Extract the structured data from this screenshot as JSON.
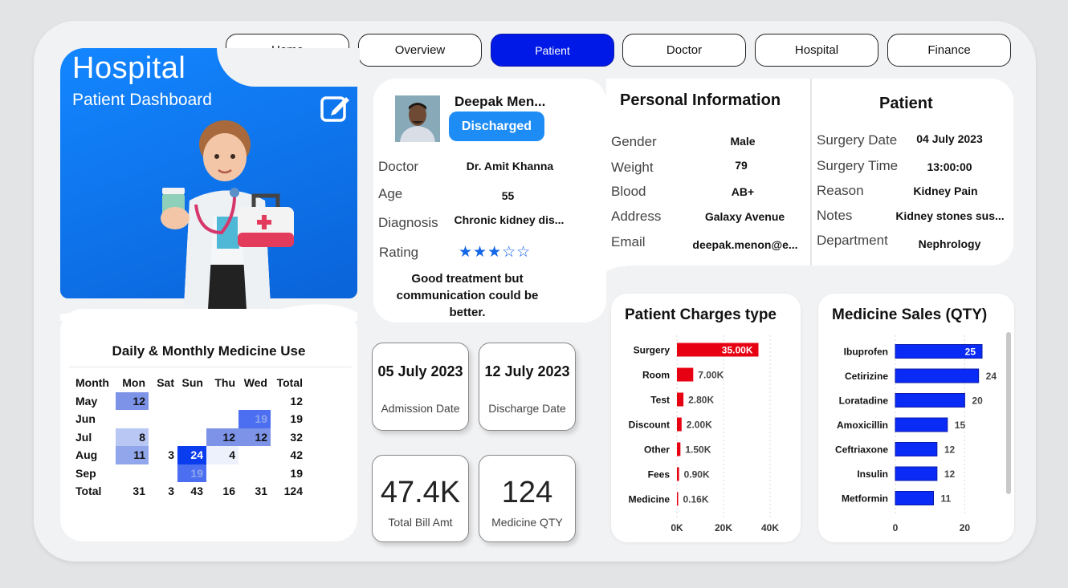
{
  "nav": [
    {
      "label": "Home",
      "active": false
    },
    {
      "label": "Overview",
      "active": false
    },
    {
      "label": "Patient",
      "active": true
    },
    {
      "label": "Doctor",
      "active": false
    },
    {
      "label": "Hospital",
      "active": false
    },
    {
      "label": "Finance",
      "active": false
    }
  ],
  "hero": {
    "title": "Hospital",
    "subtitle": "Patient Dashboard"
  },
  "medicine_use": {
    "title": "Daily & Monthly Medicine Use",
    "columns": [
      "Month",
      "Mon",
      "Sat",
      "Sun",
      "Thu",
      "Wed",
      "Total"
    ],
    "rows": [
      {
        "month": "May",
        "Mon": "12",
        "Sat": "",
        "Sun": "",
        "Thu": "",
        "Wed": "",
        "Total": "12"
      },
      {
        "month": "Jun",
        "Mon": "",
        "Sat": "",
        "Sun": "",
        "Thu": "",
        "Wed": "19",
        "Total": "19"
      },
      {
        "month": "Jul",
        "Mon": "8",
        "Sat": "",
        "Sun": "",
        "Thu": "12",
        "Wed": "12",
        "Total": "32"
      },
      {
        "month": "Aug",
        "Mon": "11",
        "Sat": "3",
        "Sun": "24",
        "Thu": "4",
        "Wed": "",
        "Total": "42"
      },
      {
        "month": "Sep",
        "Mon": "",
        "Sat": "",
        "Sun": "19",
        "Thu": "",
        "Wed": "",
        "Total": "19"
      }
    ],
    "total_row": {
      "month": "Total",
      "Mon": "31",
      "Sat": "3",
      "Sun": "43",
      "Thu": "16",
      "Wed": "31",
      "Total": "124"
    }
  },
  "patient": {
    "name": "Deepak Men...",
    "status": "Discharged",
    "doctor_label": "Doctor",
    "doctor": "Dr. Amit Khanna",
    "age_label": "Age",
    "age": "55",
    "diagnosis_label": "Diagnosis",
    "diagnosis": "Chronic kidney dis...",
    "rating_label": "Rating",
    "rating": 3,
    "rating_max": 5,
    "review": "Good treatment but communication could be better."
  },
  "personal": {
    "title": "Personal Information",
    "gender_label": "Gender",
    "gender": "Male",
    "weight_label": "Weight",
    "weight": "79",
    "blood_label": "Blood",
    "blood": "AB+",
    "address_label": "Address",
    "address": "Galaxy Avenue",
    "email_label": "Email",
    "email": "deepak.menon@e..."
  },
  "surgery": {
    "title": "Patient",
    "date_label": "Surgery Date",
    "date": "04 July 2023",
    "time_label": "Surgery Time",
    "time": "13:00:00",
    "reason_label": "Reason",
    "reason": "Kidney Pain",
    "notes_label": "Notes",
    "notes": "Kidney stones sus...",
    "dept_label": "Department",
    "dept": "Nephrology"
  },
  "tiles": {
    "admission_date": "05 July 2023",
    "admission_caption": "Admission Date",
    "discharge_date": "12 July 2023",
    "discharge_caption": "Discharge Date",
    "total_bill": "47.4K",
    "total_bill_caption": "Total Bill Amt",
    "medicine_qty": "124",
    "medicine_qty_caption": "Medicine QTY"
  },
  "colors": {
    "accent": "#0019e6",
    "hero": "#1386ff",
    "charges_bar": "#e60012",
    "sales_bar": "#0a2af5"
  },
  "chart_data": [
    {
      "type": "bar",
      "orientation": "horizontal",
      "title": "Patient Charges type",
      "categories": [
        "Surgery",
        "Room",
        "Test",
        "Discount",
        "Other",
        "Fees",
        "Medicine"
      ],
      "values": [
        35000,
        7000,
        2800,
        2000,
        1500,
        900,
        160
      ],
      "value_labels": [
        "35.00K",
        "7.00K",
        "2.80K",
        "2.00K",
        "1.50K",
        "0.90K",
        "0.16K"
      ],
      "xticks": [
        "0K",
        "20K",
        "40K"
      ],
      "xlim": [
        0,
        40000
      ],
      "grid": true
    },
    {
      "type": "bar",
      "orientation": "horizontal",
      "title": "Medicine Sales (QTY)",
      "categories": [
        "Ibuprofen",
        "Cetirizine",
        "Loratadine",
        "Amoxicillin",
        "Ceftriaxone",
        "Insulin",
        "Metformin"
      ],
      "values": [
        25,
        24,
        20,
        15,
        12,
        12,
        11
      ],
      "xticks": [
        "0",
        "20"
      ],
      "xlim": [
        0,
        31
      ],
      "grid": true
    }
  ]
}
